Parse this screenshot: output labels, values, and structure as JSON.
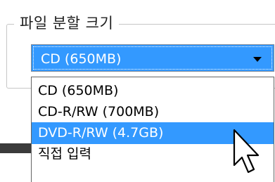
{
  "groupbox": {
    "title": "파일 분할 크기"
  },
  "combo": {
    "selected_value": "CD (650MB)"
  },
  "dropdown": {
    "options": [
      {
        "label": "CD (650MB)",
        "highlighted": false
      },
      {
        "label": "CD-R/RW (700MB)",
        "highlighted": false
      },
      {
        "label": "DVD-R/RW (4.7GB)",
        "highlighted": true
      },
      {
        "label": "직접 입력",
        "highlighted": false
      }
    ]
  },
  "icons": {
    "combo_arrow": "chevron-down-icon",
    "cursor": "mouse-pointer-icon"
  },
  "colors": {
    "selection": "#3399ff",
    "selection_text": "#ffffff",
    "frame": "#c6c6c6"
  }
}
